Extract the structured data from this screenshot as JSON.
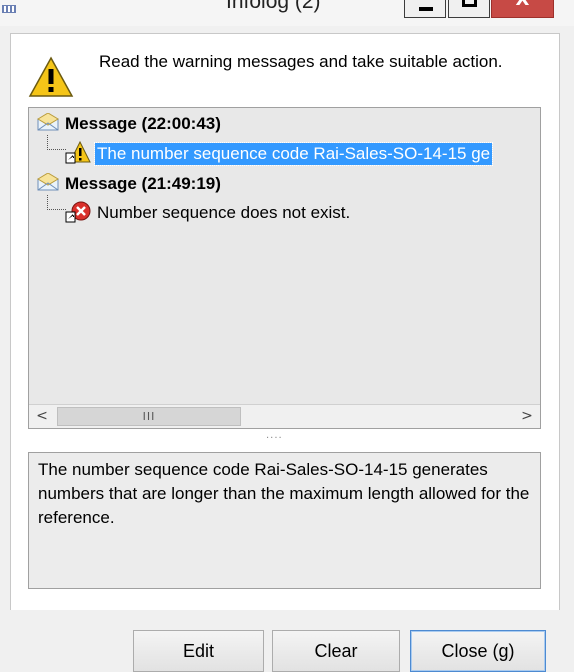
{
  "window": {
    "title": "Infolog (2)",
    "close_glyph": "X"
  },
  "header": {
    "icon": "warning-icon",
    "text": "Read the warning messages and take suitable action."
  },
  "tree": {
    "nodes": [
      {
        "label": "Message (22:00:43)",
        "icon": "message-envelope-icon",
        "child": {
          "text": "The number sequence code Rai-Sales-SO-14-15 ge",
          "icon": "warning-icon",
          "selected": true
        }
      },
      {
        "label": "Message (21:49:19)",
        "icon": "message-envelope-icon",
        "child": {
          "text": "Number sequence  does not exist.",
          "icon": "error-icon",
          "selected": false
        }
      }
    ],
    "scrollbar": {
      "left_arrow": "<",
      "right_arrow": ">",
      "thumb_grip": "III"
    }
  },
  "splitter_grip": "....",
  "details": {
    "text": "The number sequence code Rai-Sales-SO-14-15 generates numbers that are longer than the maximum length allowed for the reference."
  },
  "buttons": {
    "edit": "Edit",
    "clear": "Clear",
    "close": "Close (g)"
  },
  "colors": {
    "selection": "#3399ff",
    "close_button": "#c74a45",
    "warning": "#f5c518",
    "error": "#d9302b"
  }
}
